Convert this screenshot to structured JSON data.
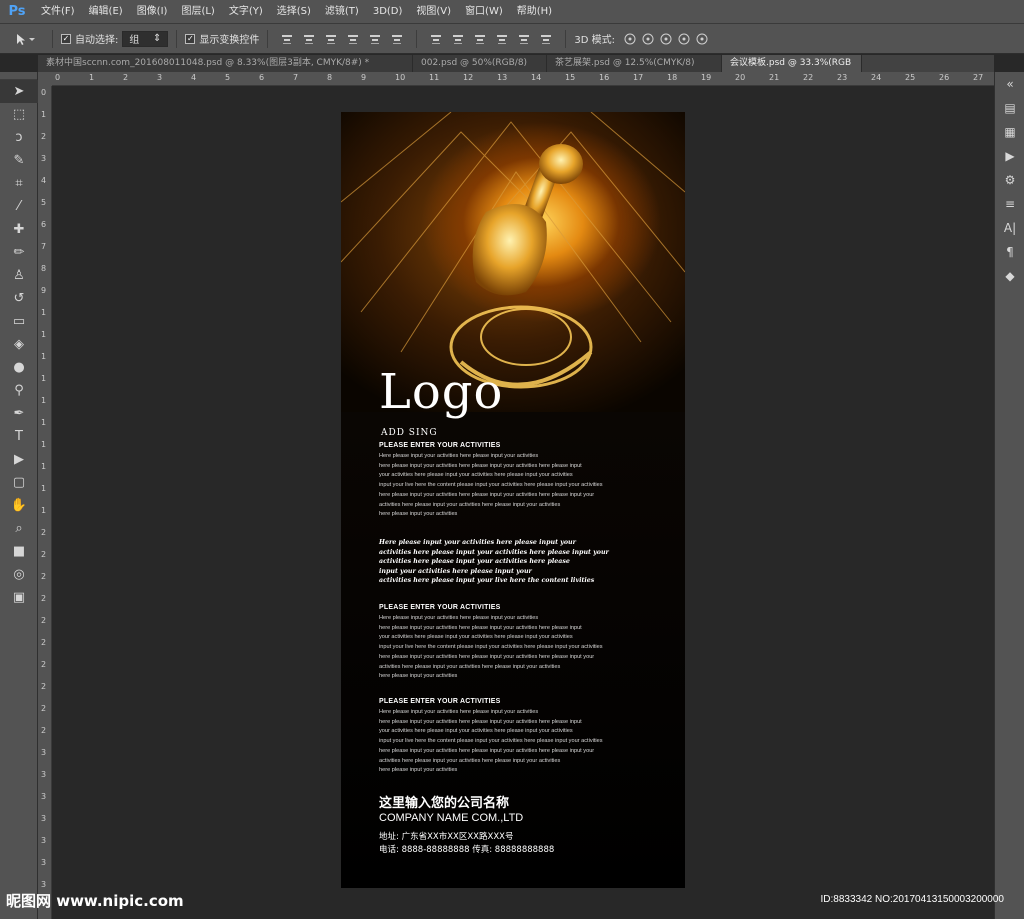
{
  "app": {
    "logo": "Ps"
  },
  "menu": [
    "文件(F)",
    "编辑(E)",
    "图像(I)",
    "图层(L)",
    "文字(Y)",
    "选择(S)",
    "滤镜(T)",
    "3D(D)",
    "视图(V)",
    "窗口(W)",
    "帮助(H)"
  ],
  "options": {
    "auto_select_label": "自动选择:",
    "auto_select_value": "组",
    "show_transform_label": "显示变换控件",
    "mode_3d_label": "3D 模式:"
  },
  "tabs": [
    {
      "label": "素材中国sccnn.com_201608011048.psd @ 8.33%(图层3副本, CMYK/8#) *",
      "active": false
    },
    {
      "label": "002.psd @ 50%(RGB/8)",
      "active": false
    },
    {
      "label": "茶艺展架.psd @ 12.5%(CMYK/8)",
      "active": false
    },
    {
      "label": "会议模板.psd @ 33.3%(RGB",
      "active": true
    }
  ],
  "ruler_top": [
    "0",
    "1",
    "2",
    "3",
    "4",
    "5",
    "6",
    "7",
    "8",
    "9",
    "10",
    "11",
    "12",
    "13",
    "14",
    "15",
    "16",
    "17",
    "18",
    "19",
    "20",
    "21",
    "22",
    "23",
    "24",
    "25",
    "26",
    "27"
  ],
  "ruler_left": [
    "0",
    "1",
    "2",
    "3",
    "4",
    "5",
    "6",
    "7",
    "8",
    "9",
    "1",
    "1",
    "1",
    "1",
    "1",
    "1",
    "1",
    "1",
    "1",
    "1",
    "2",
    "2",
    "2",
    "2",
    "2",
    "2",
    "2",
    "2",
    "2",
    "2",
    "3",
    "3",
    "3",
    "3",
    "3",
    "3",
    "3"
  ],
  "document": {
    "logo": "Logo",
    "tagline": "ADD SING",
    "blocks": [
      {
        "heading": "PLEASE ENTER YOUR ACTIVITIES",
        "lines": [
          "Here please input your activities here please input your activities",
          "here please input your activities here please input your activities here please input",
          "your activities here please input your activities here please input your activities",
          "input your live here the content please input your activities here please input your activities",
          "here please input your activities here please input your activities here please input your",
          "activities here please input your activities here please input your activities",
          "here please input your activities"
        ]
      },
      {
        "heading": "PLEASE ENTER YOUR ACTIVITIES",
        "lines": [
          "Here please input your activities here please input your activities",
          "here please input your activities here please input your activities here please input",
          "your activities here please input your activities here please input your activities",
          "input your live here the content please input your activities here please input your activities",
          "here please input your activities here please input your activities here please input your",
          "activities here please input your activities here please input your activities",
          "here please input your activities"
        ]
      },
      {
        "heading": "PLEASE ENTER YOUR ACTIVITIES",
        "lines": [
          "Here please input your activities here please input your activities",
          "here please input your activities here please input your activities here please input",
          "your activities here please input your activities here please input your activities",
          "input your live here the content please input your activities here please input your activities",
          "here please input your activities here please input your activities here please input your",
          "activities here please input your activities here please input your activities",
          "here please input your activities"
        ]
      }
    ],
    "script_lines": [
      "Here please input your activities here please input your",
      "activities here please input your activities here please input your",
      "activities here please input your activities here please",
      "input your activities here please input your",
      "activities here please input your live here the content livities"
    ],
    "company_cn": "这里输入您的公司名称",
    "company_en": "COMPANY NAME COM.,LTD",
    "address": "地址:  广东省XX市XX区XX路XXX号",
    "phone": "电话:  8888-88888888  传真:  88888888888"
  },
  "watermark": {
    "left": "昵图网 www.nipic.com",
    "right": "ID:8833342 NO:20170413150003200000"
  },
  "colors": {
    "ps_blue": "#4fa3f7",
    "panel": "#535353",
    "workspace": "#282828"
  }
}
